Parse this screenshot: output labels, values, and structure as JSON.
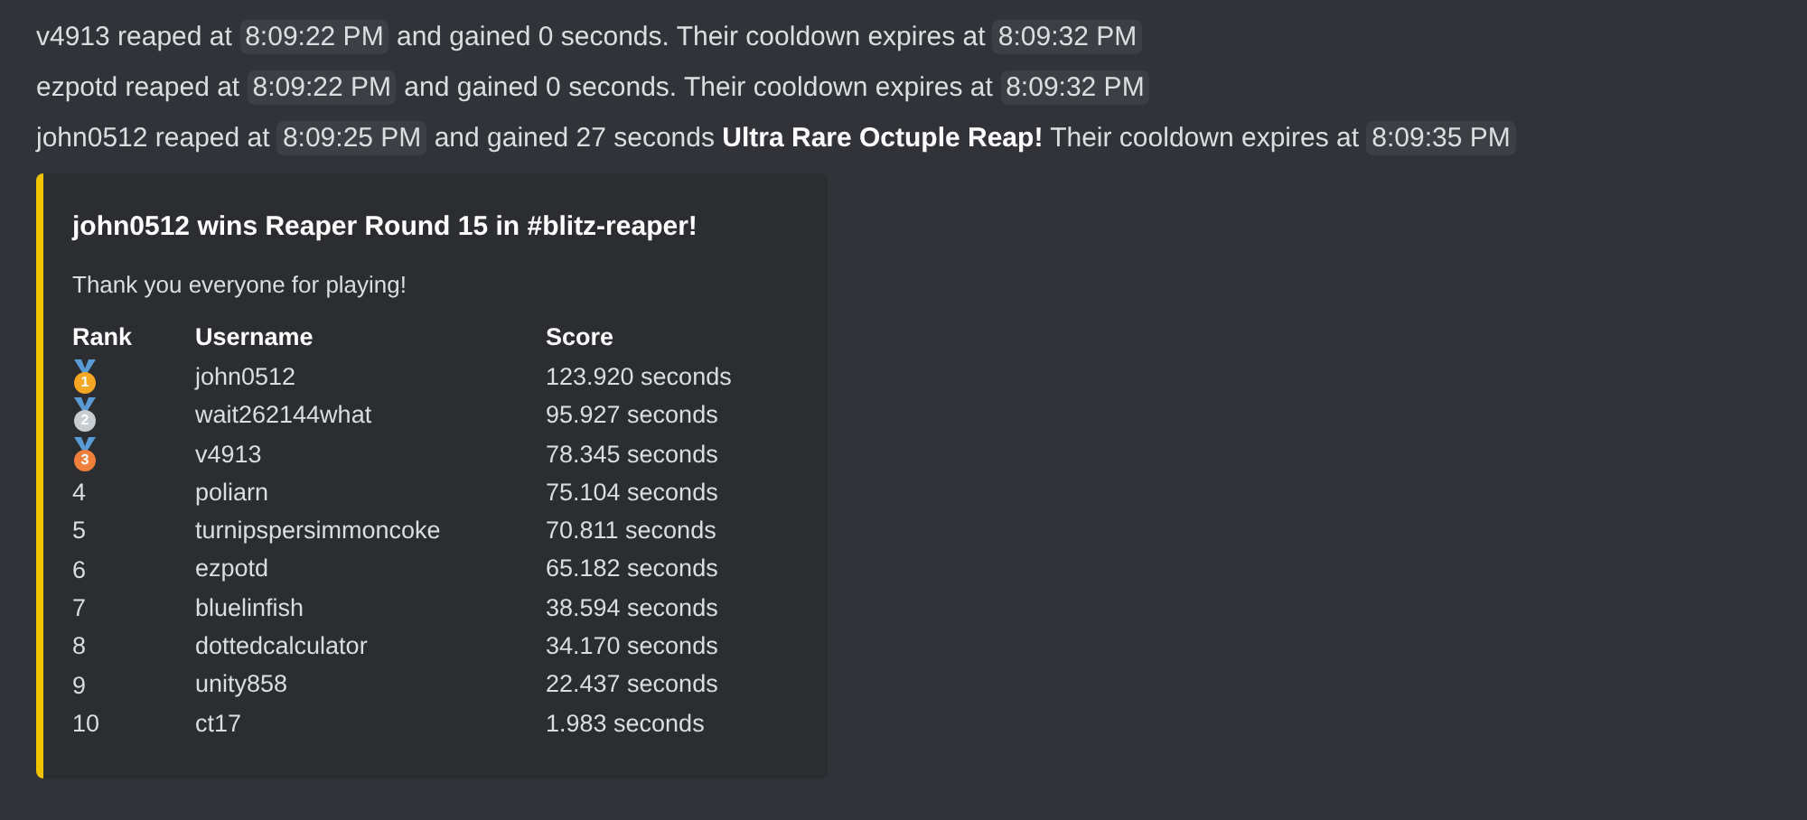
{
  "messages": [
    {
      "parts": [
        {
          "kind": "text",
          "text": "v4913 reaped at "
        },
        {
          "kind": "time",
          "text": "8:09:22 PM"
        },
        {
          "kind": "text",
          "text": " and gained 0 seconds. Their cooldown expires at "
        },
        {
          "kind": "time",
          "text": "8:09:32 PM"
        }
      ]
    },
    {
      "parts": [
        {
          "kind": "text",
          "text": "ezpotd reaped at "
        },
        {
          "kind": "time",
          "text": "8:09:22 PM"
        },
        {
          "kind": "text",
          "text": " and gained 0 seconds. Their cooldown expires at "
        },
        {
          "kind": "time",
          "text": "8:09:32 PM"
        }
      ]
    },
    {
      "parts": [
        {
          "kind": "text",
          "text": "john0512 reaped at "
        },
        {
          "kind": "time",
          "text": "8:09:25 PM"
        },
        {
          "kind": "text",
          "text": " and gained 27 seconds "
        },
        {
          "kind": "bold",
          "text": "Ultra Rare Octuple Reap!"
        },
        {
          "kind": "text",
          "text": " Their cooldown expires at "
        },
        {
          "kind": "time",
          "text": "8:09:35 PM"
        }
      ]
    }
  ],
  "embed": {
    "color": "#f0c400",
    "title": "john0512 wins Reaper Round 15 in #blitz-reaper!",
    "description": "Thank you everyone for playing!",
    "columns": [
      "Rank",
      "Username",
      "Score"
    ],
    "rows": [
      {
        "kind": "medal",
        "color": "#f5a623",
        "rank": "1",
        "username": "john0512",
        "score": "123.920 seconds"
      },
      {
        "kind": "medal",
        "color": "#c7ccd1",
        "rank": "2",
        "username": "wait262144what",
        "score": "95.927 seconds"
      },
      {
        "kind": "medal",
        "color": "#f07f3c",
        "rank": "3",
        "username": "v4913",
        "score": "78.345 seconds"
      },
      {
        "kind": "number",
        "rank": "4",
        "username": "poliarn",
        "score": "75.104 seconds"
      },
      {
        "kind": "number",
        "rank": "5",
        "username": "turnipspersimmoncoke",
        "score": "70.811 seconds"
      },
      {
        "kind": "number",
        "rank": "6",
        "username": "ezpotd",
        "score": "65.182 seconds"
      },
      {
        "kind": "number",
        "rank": "7",
        "username": "bluelinfish",
        "score": "38.594 seconds"
      },
      {
        "kind": "number",
        "rank": "8",
        "username": "dottedcalculator",
        "score": "34.170 seconds"
      },
      {
        "kind": "number",
        "rank": "9",
        "username": "unity858",
        "score": "22.437 seconds"
      },
      {
        "kind": "number",
        "rank": "10",
        "username": "ct17",
        "score": "1.983 seconds"
      }
    ]
  }
}
